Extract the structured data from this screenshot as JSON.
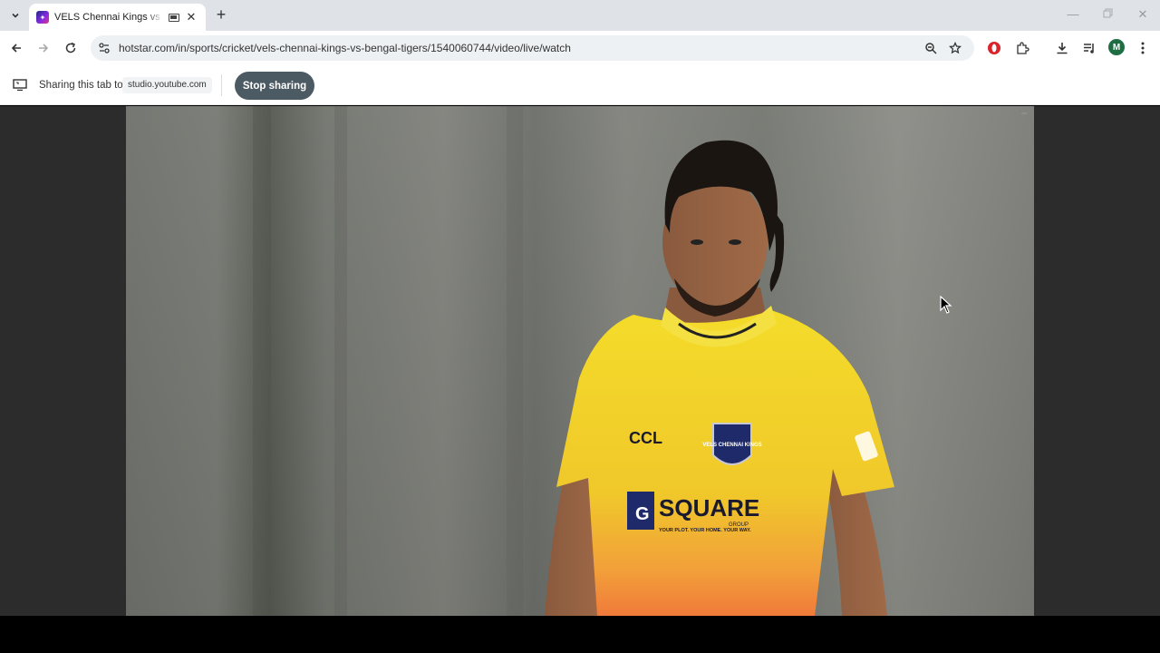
{
  "tab": {
    "title": "VELS Chennai Kings vs Bengal Tigers"
  },
  "address_bar": {
    "url": "hotstar.com/in/sports/cricket/vels-chennai-kings-vs-bengal-tigers/1540060744/video/live/watch"
  },
  "profile": {
    "initial": "M"
  },
  "share_bar": {
    "label": "Sharing this tab to",
    "target": "studio.youtube.com",
    "stop_label": "Stop sharing"
  },
  "video": {
    "jersey_sponsor": "CCL",
    "team_badge": "VELS CHENNAI KINGS",
    "jersey_brand": "SQUARE",
    "jersey_brand_g": "G",
    "jersey_brand_sub": "GROUP",
    "jersey_tagline": "YOUR PLOT. YOUR HOME. YOUR WAY."
  },
  "colors": {
    "jersey": "#f2d423",
    "stop_button": "#4c5a63",
    "profile": "#1f6e43"
  },
  "icons": [
    "chevron-down-icon",
    "media-icon",
    "close-icon",
    "plus-icon",
    "minimize-icon",
    "restore-icon",
    "back-icon",
    "forward-icon",
    "reload-icon",
    "site-info-icon",
    "zoom-icon",
    "bookmark-star-icon",
    "opera-icon",
    "extensions-icon",
    "download-icon",
    "media-control-icon",
    "menu-icon",
    "screen-share-icon",
    "cursor-icon"
  ]
}
